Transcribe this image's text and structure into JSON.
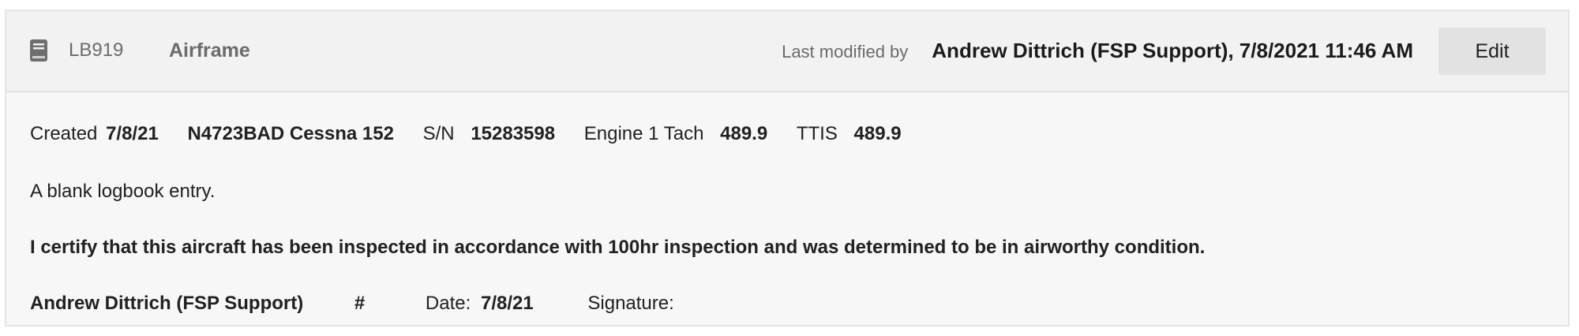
{
  "header": {
    "book_icon": "logbook-icon",
    "entry_id": "LB919",
    "entry_type": "Airframe",
    "last_modified_label": "Last modified by",
    "last_modified_value": "Andrew Dittrich (FSP Support), 7/8/2021 11:46 AM",
    "edit_label": "Edit"
  },
  "meta": {
    "created_label": "Created",
    "created_date": "7/8/21",
    "aircraft": "N4723BAD Cessna 152",
    "serial_label": "S/N",
    "serial_value": "15283598",
    "tach_label": "Engine 1 Tach",
    "tach_value": "489.9",
    "ttis_label": "TTIS",
    "ttis_value": "489.9"
  },
  "body": {
    "description": "A blank logbook entry.",
    "certification": "I certify that this aircraft has been inspected in accordance with 100hr inspection and was determined to be in airworthy condition."
  },
  "signoff": {
    "name": "Andrew Dittrich (FSP Support)",
    "number_label": "#",
    "date_label": "Date:",
    "date_value": "7/8/21",
    "signature_label": "Signature:"
  },
  "colors": {
    "card_background": "#f7f7f7",
    "header_background": "#f2f2f2",
    "button_background": "#e2e2e2",
    "muted_text": "#6b6b6b"
  }
}
